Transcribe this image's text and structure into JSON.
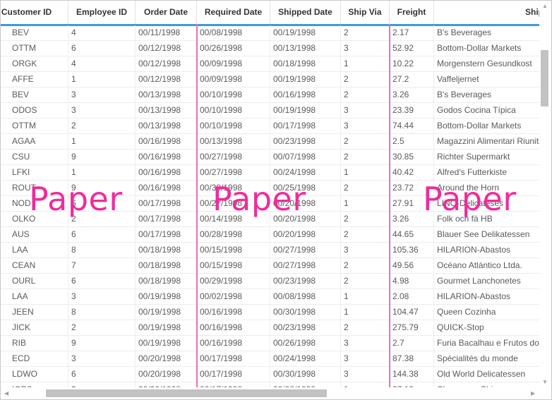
{
  "columns": [
    {
      "key": "customer_id",
      "label": "Customer ID"
    },
    {
      "key": "employee_id",
      "label": "Employee ID"
    },
    {
      "key": "order_date",
      "label": "Order Date"
    },
    {
      "key": "required_date",
      "label": "Required Date"
    },
    {
      "key": "shipped_date",
      "label": "Shipped Date"
    },
    {
      "key": "ship_via",
      "label": "Ship Via"
    },
    {
      "key": "freight",
      "label": "Freight"
    },
    {
      "key": "ship_name",
      "label": "Ship Name"
    }
  ],
  "rows": [
    [
      "BEV",
      "4",
      "00/11/1998",
      "00/08/1998",
      "00/19/1998",
      "2",
      "2.17",
      "B's Beverages"
    ],
    [
      "OTTM",
      "6",
      "00/12/1998",
      "00/26/1998",
      "00/13/1998",
      "3",
      "52.92",
      "Bottom-Dollar Markets"
    ],
    [
      "ORGK",
      "4",
      "00/12/1998",
      "00/09/1998",
      "00/18/1998",
      "1",
      "10.22",
      "Morgenstern Gesundkost"
    ],
    [
      "AFFE",
      "1",
      "00/12/1998",
      "00/09/1998",
      "00/19/1998",
      "2",
      "27.2",
      "Vaffeljernet"
    ],
    [
      "BEV",
      "3",
      "00/13/1998",
      "00/10/1998",
      "00/16/1998",
      "2",
      "3.26",
      "B's Beverages"
    ],
    [
      "ODOS",
      "3",
      "00/13/1998",
      "00/10/1998",
      "00/19/1998",
      "3",
      "23.39",
      "Godos Cocina Típica"
    ],
    [
      "OTTM",
      "2",
      "00/13/1998",
      "00/10/1998",
      "00/17/1998",
      "3",
      "74.44",
      "Bottom-Dollar Markets"
    ],
    [
      "AGAA",
      "1",
      "00/16/1998",
      "00/13/1998",
      "00/23/1998",
      "2",
      "2.5",
      "Magazzini Alimentari Riuniti"
    ],
    [
      "CSU",
      "9",
      "00/16/1998",
      "00/27/1998",
      "00/07/1998",
      "2",
      "30.85",
      "Richter Supermarkt"
    ],
    [
      "LFKI",
      "1",
      "00/16/1998",
      "00/27/1998",
      "00/24/1998",
      "1",
      "40.42",
      "Alfred's Futterkiste"
    ],
    [
      "ROUT",
      "9",
      "00/16/1998",
      "00/30/1998",
      "00/25/1998",
      "2",
      "23.72",
      "Around the Horn"
    ],
    [
      "NOD",
      "6",
      "00/17/1998",
      "00/27/1998",
      "00/20/1998",
      "1",
      "27.91",
      "LINO-Delicateses"
    ],
    [
      "OLKO",
      "2",
      "00/17/1998",
      "00/14/1998",
      "00/20/1998",
      "2",
      "3.26",
      "Folk och fä HB"
    ],
    [
      "AUS",
      "6",
      "00/17/1998",
      "00/28/1998",
      "00/20/1998",
      "2",
      "44.65",
      "Blauer See Delikatessen"
    ],
    [
      "LAA",
      "8",
      "00/18/1998",
      "00/15/1998",
      "00/27/1998",
      "3",
      "105.36",
      "HILARION-Abastos"
    ],
    [
      "CEAN",
      "7",
      "00/18/1998",
      "00/15/1998",
      "00/27/1998",
      "2",
      "49.56",
      "Océano Atlántico Ltda."
    ],
    [
      "OURL",
      "6",
      "00/18/1998",
      "00/29/1998",
      "00/23/1998",
      "2",
      "4.98",
      "Gourmet Lanchonetes"
    ],
    [
      "LAA",
      "3",
      "00/19/1998",
      "00/02/1998",
      "00/08/1998",
      "1",
      "2.08",
      "HILARION-Abastos"
    ],
    [
      "JEEN",
      "8",
      "00/19/1998",
      "00/16/1998",
      "00/30/1998",
      "1",
      "104.47",
      "Queen Cozinha"
    ],
    [
      "JICK",
      "2",
      "00/19/1998",
      "00/16/1998",
      "00/23/1998",
      "2",
      "275.79",
      "QUICK-Stop"
    ],
    [
      "RIB",
      "9",
      "00/19/1998",
      "00/16/1998",
      "00/26/1998",
      "3",
      "2.7",
      "Furia Bacalhau e Frutos do Mar"
    ],
    [
      "ECD",
      "3",
      "00/20/1998",
      "00/17/1998",
      "00/24/1998",
      "3",
      "87.38",
      "Spécialités du monde"
    ],
    [
      "LDWO",
      "6",
      "00/20/1998",
      "00/17/1998",
      "00/30/1998",
      "3",
      "144.38",
      "Old World Delicatessen"
    ],
    [
      "IOPS",
      "3",
      "00/20/1998",
      "00/17/1998",
      "00/08/1998",
      "1",
      "27.19",
      "Chop-suey Chinese"
    ]
  ],
  "watermarks": [
    "Paper",
    "Paper",
    "Paper"
  ],
  "colors": {
    "header_underline": "#3e9bd6",
    "frozen_line": "#ee6fb6",
    "watermark": "#f02b9b"
  },
  "icons": {
    "scroll_left": "triangle-left-icon",
    "scroll_right": "triangle-right-icon",
    "scroll_up": "triangle-up-icon",
    "scroll_down": "triangle-down-icon"
  }
}
